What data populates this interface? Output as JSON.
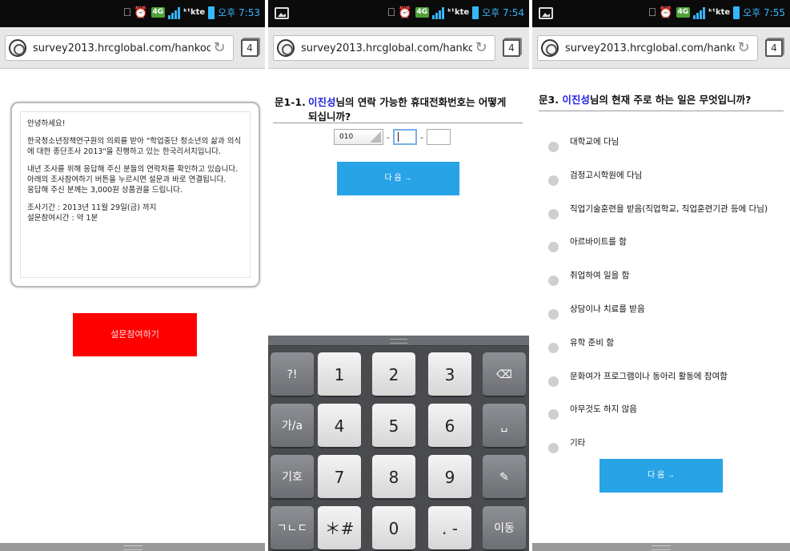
{
  "screens": [
    {
      "status_time": "오후 7:53",
      "url": "survey2013.hrcglobal.com/hankook_mobi",
      "tab_count": "4",
      "notice": {
        "greeting": "안녕하세요!",
        "para1": "한국청소년정책연구원의 의뢰를 받아 \"학업중단 청소년의 삶과 의식에 대한 종단조사 2013\"을 진행하고 있는 한국리서치입니다.",
        "para2a": "내년 조사를 위해 응답해 주신 분들의 연락처를 확인하고 있습니다.",
        "para2b": "아래의 조사참여하기 버튼을 누르시면 설문과 바로 연결됩니다.",
        "para2c": "응답해 주신 분께는 3,000원 상품권을 드립니다.",
        "period": "조사기간 : 2013년 11월 29일(금) 까지",
        "duration": "설문참여시간 : 약 1분"
      },
      "participate_label": "설문참여하기"
    },
    {
      "status_time": "오후 7:54",
      "url": "survey2013.hrcglobal.com/hankook_mobi",
      "tab_count": "4",
      "question": {
        "number": "문1-1.",
        "name": "이진성",
        "text_a": "님의 연락 가능한 휴대전화번호는 어떻게",
        "text_b": "되십니까?"
      },
      "phone_prefix": "010",
      "dash": "-",
      "next_label": "다 음 →",
      "keyboard": [
        [
          "?!",
          "1",
          "2",
          "3",
          "⌫"
        ],
        [
          "가/a",
          "4",
          "5",
          "6",
          "␣"
        ],
        [
          "기호",
          "7",
          "8",
          "9",
          "✎"
        ],
        [
          "ㄱㄴㄷ",
          "＊#",
          "0",
          ". -",
          "이동"
        ]
      ]
    },
    {
      "status_time": "오후 7:55",
      "url": "survey2013.hrcglobal.com/hankook_mobi",
      "tab_count": "4",
      "question": {
        "number": "문3.",
        "name": "이진성",
        "text": "님의 현재 주로 하는 일은 무엇입니까?"
      },
      "options": [
        "대학교에 다님",
        "검정고시학원에 다님",
        "직업기술훈련을 받음(직업학교, 직업훈련기관 등에 다님)",
        "아르바이트를 함",
        "취업하여 일을 함",
        "상담이나 치료를 받음",
        "유학 준비 함",
        "문화여가 프로그램이나 동아리 활동에 참여함",
        "아무것도 하지 않음",
        "기타"
      ],
      "next_label": "다 음 →"
    }
  ],
  "colors": {
    "status_blue": "#36b6ff",
    "red_button": "#ff0000",
    "blue_button": "#27a3e6",
    "name_blue": "#2020e0"
  },
  "status_icons": [
    "screenshot-icon",
    "alarm-icon",
    "4g-icon",
    "signal-icon",
    "kt-icon",
    "battery-icon"
  ]
}
